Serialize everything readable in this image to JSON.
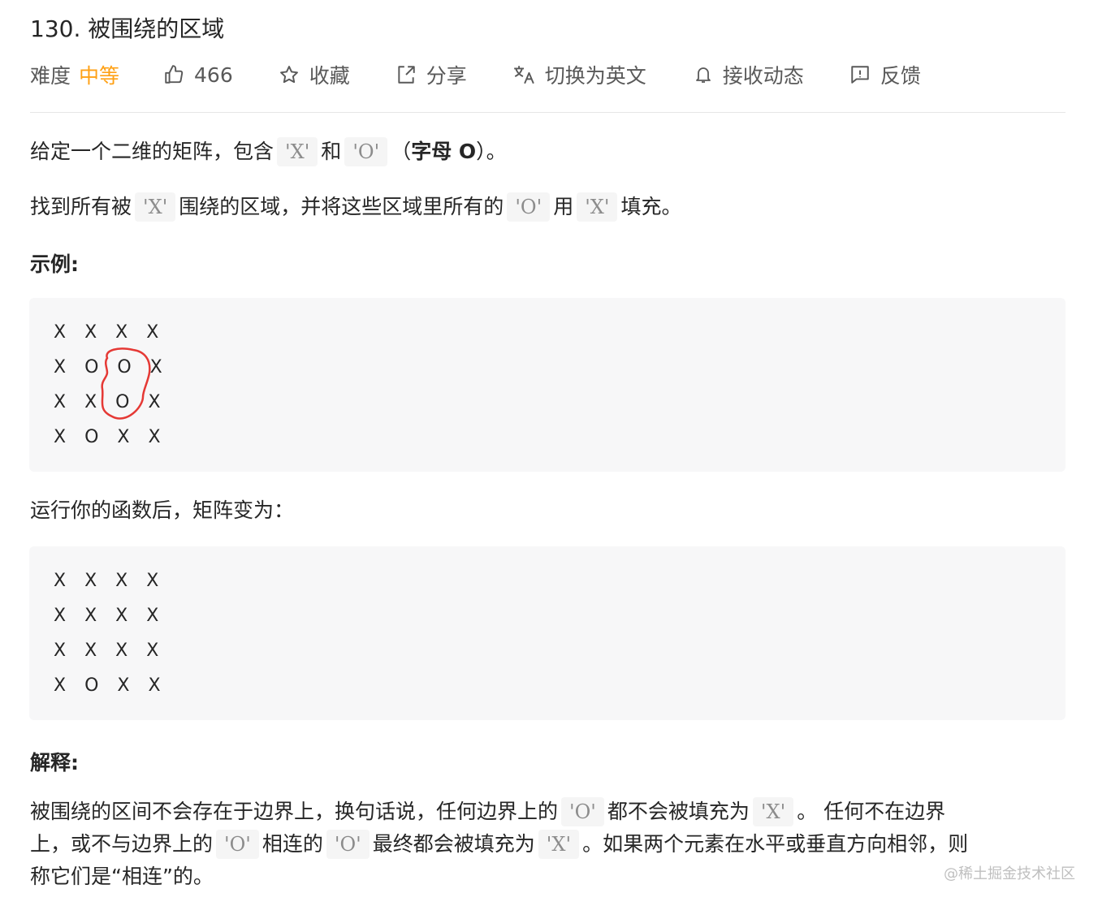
{
  "problem": {
    "title": "130. 被围绕的区域"
  },
  "toolbar": {
    "difficulty_label": "难度",
    "difficulty_value": "中等",
    "likes": "466",
    "favorite_label": "收藏",
    "share_label": "分享",
    "switch_lang_label": "切换为英文",
    "subscribe_label": "接收动态",
    "feedback_label": "反馈",
    "difficulty_color": "#ffa116"
  },
  "content": {
    "p1_part1": "给定一个二维的矩阵，包含",
    "p1_code1": "'X'",
    "p1_part2": "和",
    "p1_code2": "'O'",
    "p1_part3": "（",
    "p1_bold": "字母 O",
    "p1_part4": "）。",
    "p2_part1": "找到所有被",
    "p2_code1": "'X'",
    "p2_part2": "围绕的区域，并将这些区域里所有的",
    "p2_code2": "'O'",
    "p2_part3": "用",
    "p2_code3": "'X'",
    "p2_part4": "填充。",
    "example_heading": "示例:",
    "example_before": [
      "X X X X",
      "X O O X",
      "X X O X",
      "X O X X"
    ],
    "after_text": "运行你的函数后，矩阵变为：",
    "example_after": [
      "X X X X",
      "X X X X",
      "X X X X",
      "X O X X"
    ],
    "explain_heading": "解释:",
    "e1_part1": "被围绕的区间不会存在于边界上，换句话说，任何边界上的",
    "e1_code1": "'O'",
    "e1_part2": "都不会被填充为",
    "e1_code2": "'X'",
    "e1_part3": "。 任何不在边界",
    "e2_part1": "上，或不与边界上的",
    "e2_code1": "'O'",
    "e2_part2": "相连的",
    "e2_code2": "'O'",
    "e2_part3": "最终都会被填充为",
    "e2_code3": "'X'",
    "e2_part4": "。如果两个元素在水平或垂直方向相邻，则",
    "e3": "称它们是“相连”的。"
  },
  "watermark": "@稀土掘金技术社区",
  "annotation_color": "#e53935"
}
